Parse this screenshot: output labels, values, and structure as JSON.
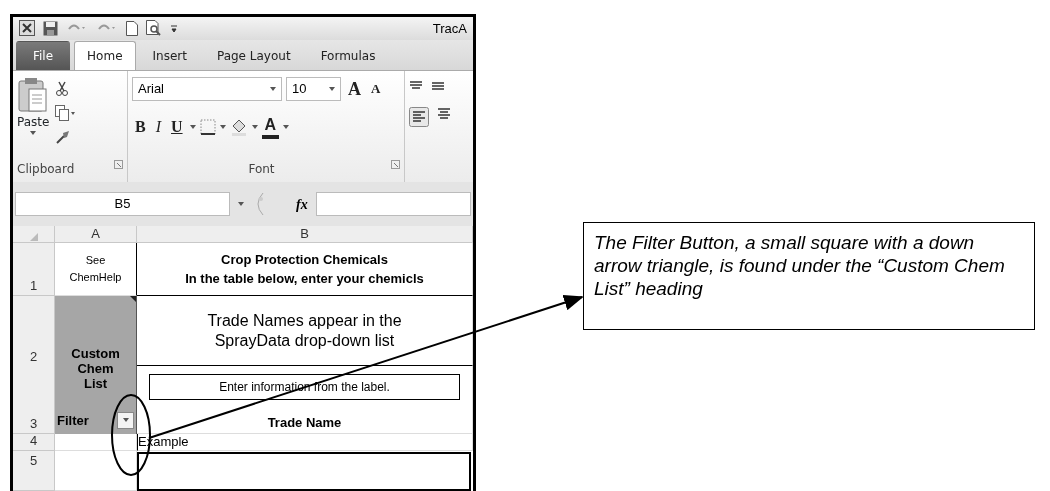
{
  "title_bar": {
    "title": "TracA"
  },
  "tabs": [
    {
      "label": "File",
      "kind": "backstage",
      "selected": false
    },
    {
      "label": "Home",
      "kind": "tab",
      "selected": true
    },
    {
      "label": "Insert",
      "kind": "tab",
      "selected": false
    },
    {
      "label": "Page Layout",
      "kind": "tab",
      "selected": false
    },
    {
      "label": "Formulas",
      "kind": "tab",
      "selected": false
    }
  ],
  "ribbon": {
    "paste_label": "Paste",
    "font_name": "Arial",
    "font_size": "10",
    "grow_font": "A",
    "shrink_font": "A",
    "bold": "B",
    "italic": "I",
    "underline": "U",
    "font_color": "A",
    "groups": [
      "Clipboard",
      "Font"
    ]
  },
  "formula_bar": {
    "name_box": "B5",
    "fx": "fx"
  },
  "sheet": {
    "columns": [
      "A",
      "B"
    ],
    "row_numbers": [
      "1",
      "2",
      "3",
      "4",
      "5"
    ],
    "see_help": "See ChemHelp",
    "table_title": "Crop Protection Chemicals",
    "table_instruction": "In the table below, enter your chemicls",
    "trade_names_note": "Trade Names appear in the SprayData drop-down list",
    "custom_list_heading": "Custom Chem List",
    "filter_label": "Filter",
    "label_hint": "Enter information from the label.",
    "trade_name_heading": "Trade Name",
    "example": "Example"
  },
  "callout": {
    "text": "The Filter Button, a small square with a down arrow triangle, is found under the “Custom Chem List” heading"
  }
}
